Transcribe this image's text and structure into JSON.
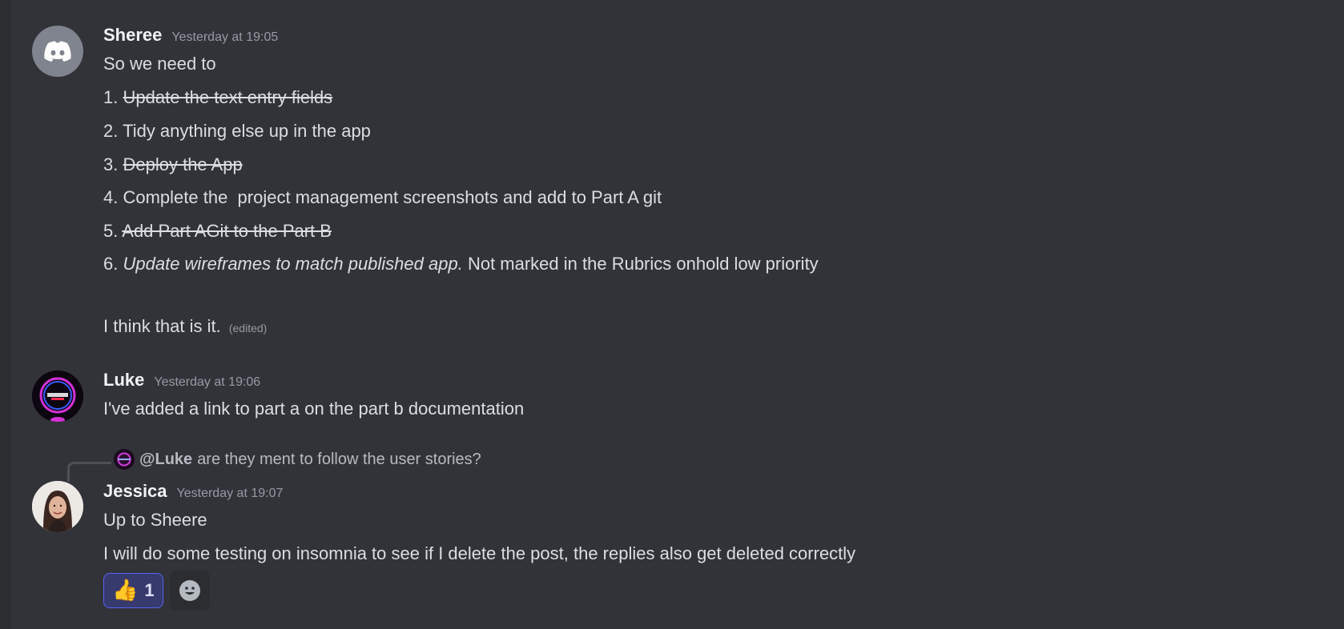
{
  "messages": [
    {
      "username": "Sheree",
      "timestamp": "Yesterday at 19:05",
      "lines": {
        "l0": "So we need to",
        "l1_num": "1.",
        "l1_text": "Update the text entry fields",
        "l2_num": "2.",
        "l2_text": "Tidy anything else up in the app",
        "l3_num": "3.",
        "l3_text": "Deploy the App",
        "l4_num": "4.",
        "l4_text": "Complete the  project management screenshots and add to Part A git",
        "l5_num": "5.",
        "l5_text": "Add Part AGit to the Part B",
        "l6_num": "6.",
        "l6_italic": "Update wireframes to match published app.",
        "l6_rest": " Not marked in the Rubrics onhold low priority",
        "l7": "I think that is it.",
        "edited": "(edited)"
      },
      "avatar_icon": "discord-logo-icon"
    },
    {
      "username": "Luke",
      "timestamp": "Yesterday at 19:06",
      "text": "I've added a link to part a on the part b documentation",
      "avatar_icon": "neon-logo-avatar"
    },
    {
      "reply": {
        "mention": "@Luke",
        "text": "are they ment to follow the user stories?"
      },
      "username": "Jessica",
      "timestamp": "Yesterday at 19:07",
      "line1": "Up to Sheere",
      "line2": "I will do some testing on insomnia to see if I delete the post, the replies also get deleted correctly",
      "reactions": [
        {
          "emoji": "👍",
          "count": "1"
        }
      ],
      "avatar_icon": "photo-avatar"
    }
  ],
  "colors": {
    "background": "#323339",
    "username": "#f2f3f5",
    "text": "#dbdee1",
    "timestamp": "#949ba4",
    "reaction_border": "#5865f2",
    "reaction_bg": "#373a6d"
  },
  "icons": {
    "add_reaction": "smiley-face-icon"
  }
}
